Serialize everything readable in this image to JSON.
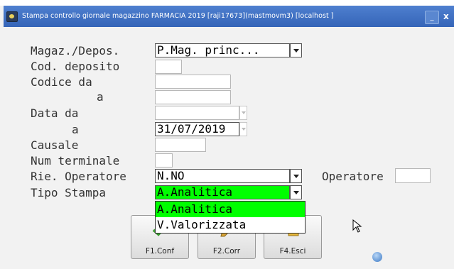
{
  "window": {
    "title": "Stampa controllo giornale magazzino FARMACIA 2019 [raji17673](mastmovm3) [localhost ]",
    "minimize_label": "_",
    "close_label": "x"
  },
  "form": {
    "magaz_label": "Magaz./Depos.",
    "magaz_value": "P.Mag. princ...",
    "cod_deposito_label": "Cod. deposito",
    "cod_deposito_value": "",
    "codice_da_label": "Codice da",
    "codice_da_value": "",
    "codice_a_label": "a",
    "codice_a_value": "",
    "data_da_label": "Data da",
    "data_da_value": "",
    "data_a_label": "a",
    "data_a_value": "31/07/2019",
    "causale_label": "Causale",
    "causale_value": "",
    "num_terminale_label": "Num terminale",
    "num_terminale_value": "",
    "rie_operatore_label": "Rie. Operatore",
    "rie_operatore_value": "N.NO",
    "operatore_label": "Operatore",
    "operatore_value": "",
    "tipo_stampa_label": "Tipo Stampa",
    "tipo_stampa_value": "A.Analitica"
  },
  "dropdown": {
    "options": [
      "A.Analitica",
      "V.Valorizzata"
    ],
    "selected_index": 0
  },
  "buttons": {
    "conf": "F1.Conf",
    "corr": "F2.Corr",
    "esci": "F4.Esci"
  },
  "colors": {
    "titlebar": "#3d6fc2",
    "selection": "#00ff00",
    "background": "#f2f2f2"
  },
  "icons": [
    "app-icon",
    "minimize-icon",
    "close-icon",
    "confirm-icon",
    "correct-icon",
    "exit-icon",
    "mouse-cursor",
    "globe-icon"
  ]
}
